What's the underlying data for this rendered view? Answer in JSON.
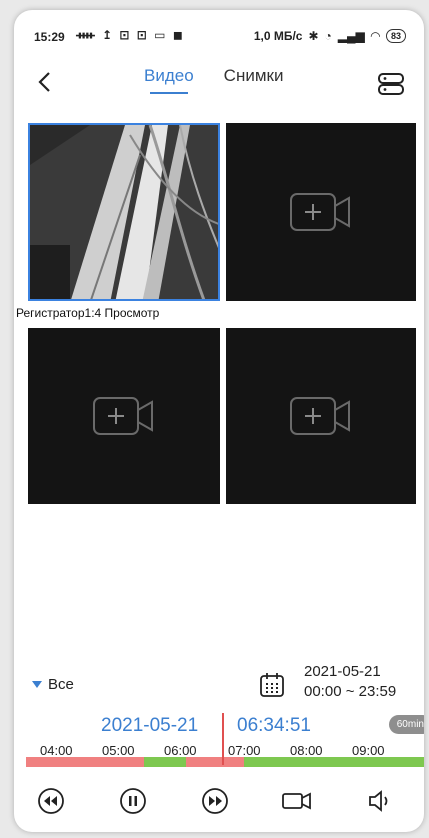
{
  "status_bar": {
    "time": "15:29",
    "left_icons": "ᚓ ↥ ⊡ ⊡ ▭ ◼",
    "right_text": "1,0 МБ/с",
    "battery": "83"
  },
  "header": {
    "tabs": [
      {
        "label": "Видео",
        "active": true
      },
      {
        "label": "Снимки",
        "active": false
      }
    ]
  },
  "grid": {
    "camera_label": "Регистратор1:4  Просмотр"
  },
  "filter": {
    "all_label": "Все",
    "date": "2021-05-21",
    "time_range": "00:00 ~ 23:59"
  },
  "timeline": {
    "current_date": "2021-05-21",
    "current_time": "06:34:51",
    "zoom": "60min",
    "ticks": [
      "04:00",
      "05:00",
      "06:00",
      "07:00",
      "08:00",
      "09:00"
    ]
  },
  "colors": {
    "accent": "#3b7fd0",
    "record_normal": "#7ec850",
    "record_alarm": "#f08080",
    "cursor": "#e05050"
  }
}
